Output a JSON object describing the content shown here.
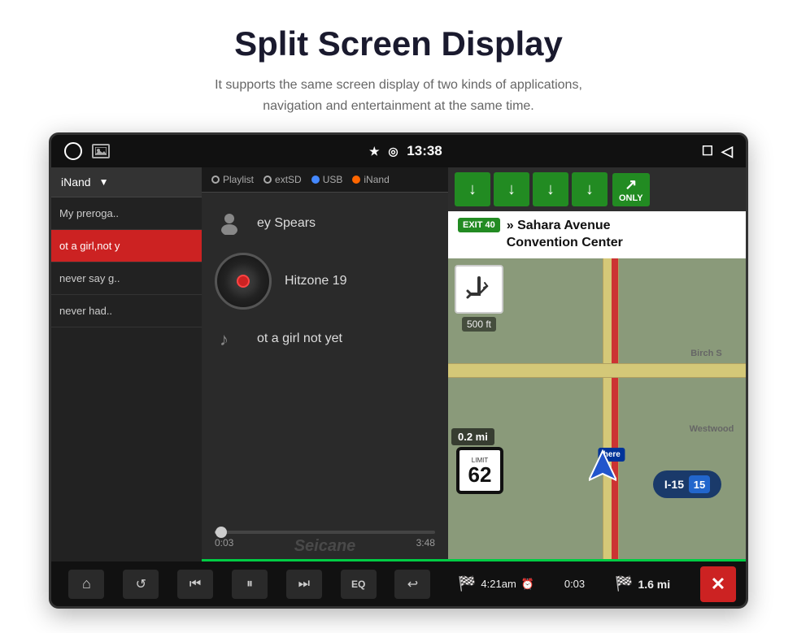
{
  "header": {
    "title": "Split Screen Display",
    "subtitle_line1": "It supports the same screen display of two kinds of applications,",
    "subtitle_line2": "navigation and entertainment at the same time."
  },
  "status_bar": {
    "time": "13:38",
    "bluetooth_icon": "bluetooth",
    "location_icon": "location-pin"
  },
  "music_player": {
    "source_selected": "iNand",
    "sources": [
      "Playlist",
      "extSD",
      "USB",
      "iNand"
    ],
    "playlist": [
      {
        "label": "My preroga..",
        "active": false
      },
      {
        "label": "ot a girl,not y",
        "active": true
      },
      {
        "label": "never say g..",
        "active": false
      },
      {
        "label": "never had..",
        "active": false
      }
    ],
    "track_artist": "ey Spears",
    "track_album": "Hitzone 19",
    "track_title": "ot a girl not yet",
    "time_current": "0:03",
    "time_total": "3:48",
    "controls": {
      "home": "⌂",
      "repeat": "↺",
      "prev": "⏮",
      "play_pause": "⏸",
      "next": "⏭",
      "eq": "EQ",
      "back": "↩"
    },
    "watermark": "Seicane"
  },
  "navigation": {
    "exit_number": "EXIT 40",
    "road_name_line1": "» Sahara Avenue",
    "road_name_line2": "Convention Center",
    "speed": "62",
    "speed_label": "LIMIT",
    "route_number": "I-15",
    "highway_number": "15",
    "bottom": {
      "arrival_time": "4:21am",
      "elapsed": "0:03",
      "remaining_distance": "1.6 mi"
    },
    "map_labels": {
      "birch": "Birch S",
      "westwood": "Westwood"
    },
    "turn_distance": "0.2 mi",
    "turn_distance2": "500 ft"
  }
}
